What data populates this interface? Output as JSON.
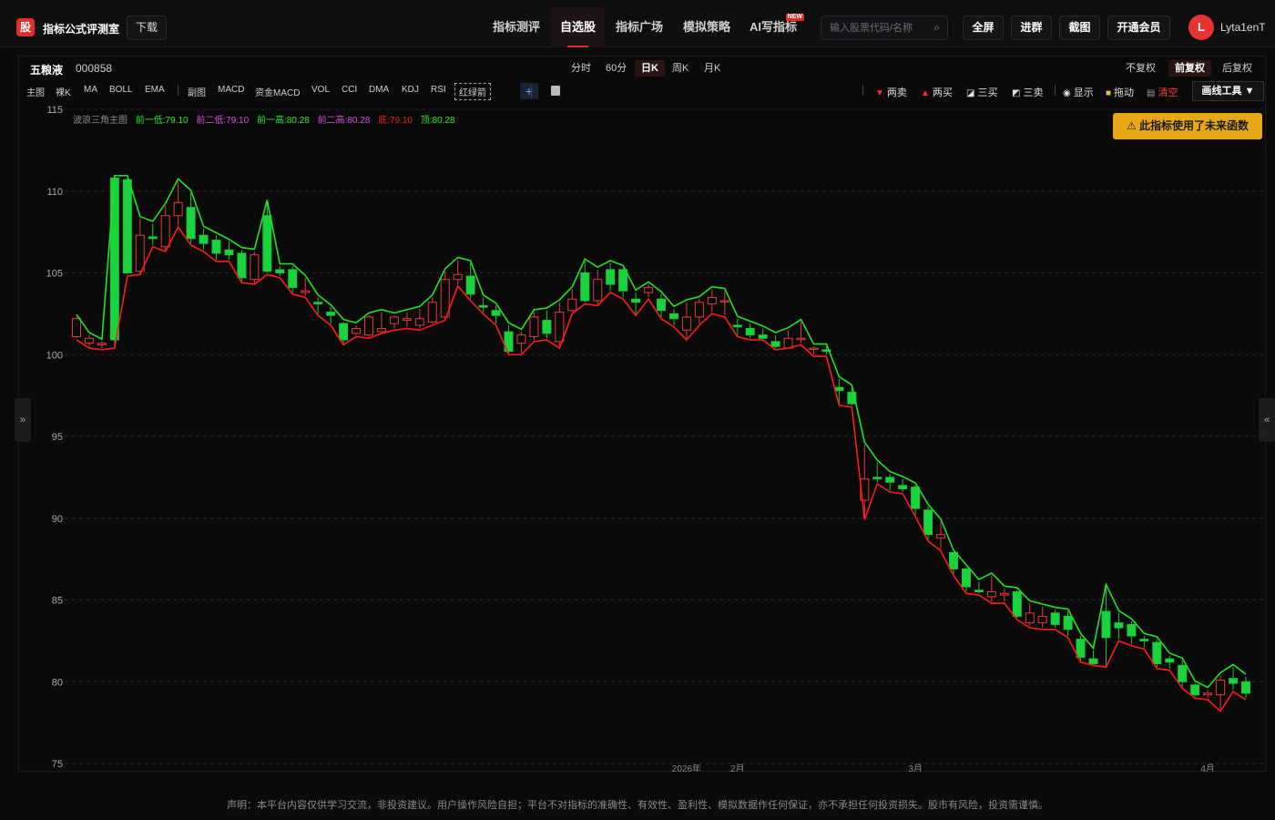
{
  "app": {
    "logo_char": "股",
    "brand": "指标公式评测室",
    "download": "下载"
  },
  "nav": [
    {
      "label": "指标测评",
      "active": false
    },
    {
      "label": "自选股",
      "active": true
    },
    {
      "label": "指标广场",
      "active": false
    },
    {
      "label": "模拟策略",
      "active": false
    },
    {
      "label": "AI写指标",
      "active": false,
      "tag": "NEW"
    }
  ],
  "search": {
    "placeholder": "输入股票代码/名称",
    "icon": "search-icon"
  },
  "top_buttons": [
    "全屏",
    "进群",
    "截图",
    "开通会员"
  ],
  "user": {
    "initial": "L",
    "name": "Lyta1enT"
  },
  "stock": {
    "name": "五粮液",
    "code": "000858"
  },
  "periods": [
    {
      "label": "分时",
      "active": false
    },
    {
      "label": "60分",
      "active": false
    },
    {
      "label": "日K",
      "active": true
    },
    {
      "label": "周K",
      "active": false
    },
    {
      "label": "月K",
      "active": false
    }
  ],
  "adjust": [
    {
      "label": "不复权",
      "active": false
    },
    {
      "label": "前复权",
      "active": true
    },
    {
      "label": "后复权",
      "active": false
    }
  ],
  "indicators_main": [
    "主图",
    "裸K",
    "MA",
    "BOLL",
    "EMA"
  ],
  "indicators_sub": [
    "副图",
    "MACD",
    "资金MACD",
    "VOL",
    "CCI",
    "DMA",
    "KDJ",
    "RSI"
  ],
  "active_indicator": "红绿箭",
  "tools": [
    {
      "label": "两卖",
      "icon": "down-triangle-icon",
      "color": "#ff2a2a"
    },
    {
      "label": "两买",
      "icon": "up-triangle-icon",
      "color": "#ff2a2a"
    },
    {
      "label": "三买",
      "icon": "trend-up-icon",
      "color": "#dddddd"
    },
    {
      "label": "三卖",
      "icon": "trend-down-icon",
      "color": "#dddddd"
    },
    {
      "label": "显示",
      "icon": "eye-icon",
      "color": "#dddddd"
    },
    {
      "label": "拖动",
      "icon": "lock-icon",
      "color": "#dddddd"
    },
    {
      "label": "清空",
      "icon": "trash-icon",
      "color": "#ff3b3b"
    }
  ],
  "draw_tools": "画线工具 ▼",
  "warning": "此指标使用了未来函数",
  "legend": [
    {
      "text": "波浪三角主图",
      "color": "#8a8a8a"
    },
    {
      "text": "前一低:79.10",
      "color": "#2ee82e"
    },
    {
      "text": "前二低:79.10",
      "color": "#d64fd6"
    },
    {
      "text": "前一高:80.28",
      "color": "#2ee82e"
    },
    {
      "text": "前二高:80.28",
      "color": "#d64fd6"
    },
    {
      "text": "底:79.10",
      "color": "#e02020"
    },
    {
      "text": "顶:80.28",
      "color": "#2ee82e"
    }
  ],
  "chart_data": {
    "type": "candlestick",
    "ylim": [
      75,
      115
    ],
    "y_ticks": [
      75,
      80,
      85,
      90,
      95,
      100,
      105,
      110,
      115
    ],
    "x_labels": [
      {
        "label": "2026年",
        "index": 48
      },
      {
        "label": "2月",
        "index": 52
      },
      {
        "label": "3月",
        "index": 66
      },
      {
        "label": "4月",
        "index": 89
      }
    ],
    "candles": [
      [
        101.1,
        102.2,
        102.3,
        101.0
      ],
      [
        100.7,
        101.0,
        101.2,
        100.5
      ],
      [
        100.6,
        100.7,
        100.8,
        100.4
      ],
      [
        110.8,
        100.9,
        110.8,
        100.5
      ],
      [
        110.7,
        105.0,
        110.8,
        104.9
      ],
      [
        105.1,
        107.3,
        108.3,
        105.0
      ],
      [
        107.2,
        107.1,
        108.0,
        106.7
      ],
      [
        106.6,
        108.5,
        109.1,
        106.4
      ],
      [
        108.5,
        109.3,
        110.6,
        107.9
      ],
      [
        109.0,
        107.1,
        109.9,
        106.8
      ],
      [
        107.3,
        106.8,
        107.7,
        106.4
      ],
      [
        107.0,
        106.2,
        107.3,
        105.8
      ],
      [
        106.4,
        106.1,
        106.9,
        105.8
      ],
      [
        106.2,
        104.7,
        106.4,
        104.5
      ],
      [
        104.6,
        106.1,
        106.3,
        104.4
      ],
      [
        108.5,
        105.1,
        109.3,
        105.0
      ],
      [
        105.2,
        105.0,
        105.4,
        104.8
      ],
      [
        105.2,
        104.1,
        105.4,
        103.8
      ],
      [
        103.8,
        103.9,
        104.7,
        103.6
      ],
      [
        103.2,
        103.1,
        103.5,
        102.5
      ],
      [
        102.6,
        102.4,
        102.9,
        101.9
      ],
      [
        101.9,
        100.9,
        102.0,
        100.7
      ],
      [
        101.3,
        101.6,
        101.8,
        101.2
      ],
      [
        101.2,
        102.3,
        102.4,
        101.1
      ],
      [
        101.4,
        101.6,
        102.6,
        101.4
      ],
      [
        101.9,
        102.3,
        102.4,
        101.6
      ],
      [
        102.1,
        102.2,
        102.6,
        101.7
      ],
      [
        101.8,
        102.2,
        102.8,
        101.6
      ],
      [
        102.0,
        103.2,
        103.5,
        101.9
      ],
      [
        102.3,
        104.6,
        105.1,
        102.2
      ],
      [
        104.6,
        104.9,
        105.8,
        104.3
      ],
      [
        104.8,
        103.7,
        105.6,
        103.4
      ],
      [
        103.0,
        102.9,
        103.5,
        102.6
      ],
      [
        102.7,
        102.4,
        103.0,
        101.9
      ],
      [
        101.4,
        100.2,
        101.8,
        100.1
      ],
      [
        100.7,
        101.2,
        101.4,
        100.1
      ],
      [
        101.1,
        102.3,
        102.6,
        100.9
      ],
      [
        102.1,
        101.3,
        102.7,
        101.0
      ],
      [
        100.8,
        102.6,
        103.2,
        100.5
      ],
      [
        102.7,
        103.4,
        104.0,
        102.6
      ],
      [
        105.0,
        103.3,
        105.7,
        103.2
      ],
      [
        103.3,
        104.6,
        105.2,
        103.1
      ],
      [
        105.2,
        104.3,
        105.6,
        103.9
      ],
      [
        105.2,
        103.9,
        105.3,
        103.5
      ],
      [
        103.4,
        103.2,
        103.8,
        102.5
      ],
      [
        103.8,
        104.1,
        104.3,
        103.5
      ],
      [
        103.4,
        102.7,
        103.7,
        102.3
      ],
      [
        102.5,
        102.2,
        102.8,
        101.8
      ],
      [
        101.5,
        102.3,
        103.2,
        101.0
      ],
      [
        102.3,
        103.2,
        103.4,
        101.9
      ],
      [
        103.1,
        103.5,
        104.0,
        102.6
      ],
      [
        103.3,
        103.3,
        103.9,
        102.4
      ],
      [
        101.8,
        101.7,
        102.2,
        101.2
      ],
      [
        101.6,
        101.2,
        101.9,
        101.0
      ],
      [
        101.2,
        101.0,
        101.6,
        101.0
      ],
      [
        100.8,
        100.5,
        101.2,
        100.4
      ],
      [
        100.4,
        101.0,
        101.5,
        100.5
      ],
      [
        101.0,
        101.0,
        102.0,
        100.7
      ],
      [
        100.4,
        100.4,
        100.5,
        100.0
      ],
      [
        100.3,
        100.2,
        100.5,
        100.0
      ],
      [
        98.0,
        97.8,
        98.5,
        97.0
      ],
      [
        97.7,
        97.0,
        98.0,
        96.9
      ],
      [
        91.1,
        92.4,
        94.5,
        90.0
      ],
      [
        92.5,
        92.4,
        93.4,
        92.2
      ],
      [
        92.5,
        92.2,
        92.7,
        91.7
      ],
      [
        92.0,
        91.8,
        92.4,
        91.6
      ],
      [
        91.9,
        90.6,
        92.0,
        90.2
      ],
      [
        90.5,
        89.0,
        90.7,
        88.7
      ],
      [
        88.8,
        89.0,
        89.8,
        88.1
      ],
      [
        87.9,
        86.9,
        87.9,
        86.6
      ],
      [
        86.9,
        85.8,
        87.0,
        85.5
      ],
      [
        85.6,
        85.5,
        86.1,
        85.4
      ],
      [
        85.2,
        85.5,
        86.5,
        84.9
      ],
      [
        85.3,
        85.4,
        85.7,
        84.9
      ],
      [
        85.5,
        84.0,
        85.6,
        83.9
      ],
      [
        83.6,
        84.2,
        84.8,
        83.4
      ],
      [
        83.6,
        84.0,
        84.6,
        83.3
      ],
      [
        84.2,
        83.5,
        84.4,
        83.3
      ],
      [
        84.0,
        83.2,
        84.3,
        82.8
      ],
      [
        82.6,
        81.5,
        82.8,
        81.3
      ],
      [
        81.4,
        81.1,
        81.9,
        81.1
      ],
      [
        84.3,
        82.7,
        85.8,
        81.0
      ],
      [
        83.6,
        83.3,
        84.2,
        82.6
      ],
      [
        83.5,
        82.8,
        83.7,
        82.3
      ],
      [
        82.6,
        82.5,
        82.8,
        82.1
      ],
      [
        82.4,
        81.1,
        82.6,
        80.9
      ],
      [
        81.4,
        81.2,
        81.6,
        80.8
      ],
      [
        81.0,
        80.0,
        81.3,
        79.7
      ],
      [
        79.8,
        79.2,
        79.9,
        79.1
      ],
      [
        79.2,
        79.3,
        79.5,
        79.0
      ],
      [
        79.2,
        80.1,
        80.4,
        78.3
      ],
      [
        80.2,
        79.9,
        80.9,
        79.5
      ],
      [
        80.0,
        79.3,
        80.3,
        79.0
      ]
    ]
  },
  "disclaimer": "声明：本平台内容仅供学习交流，非投资建议。用户操作风险自担；平台不对指标的准确性、有效性、盈利性、模拟数据作任何保证，亦不承担任何投资损失。股市有风险，投资需谨慎。"
}
